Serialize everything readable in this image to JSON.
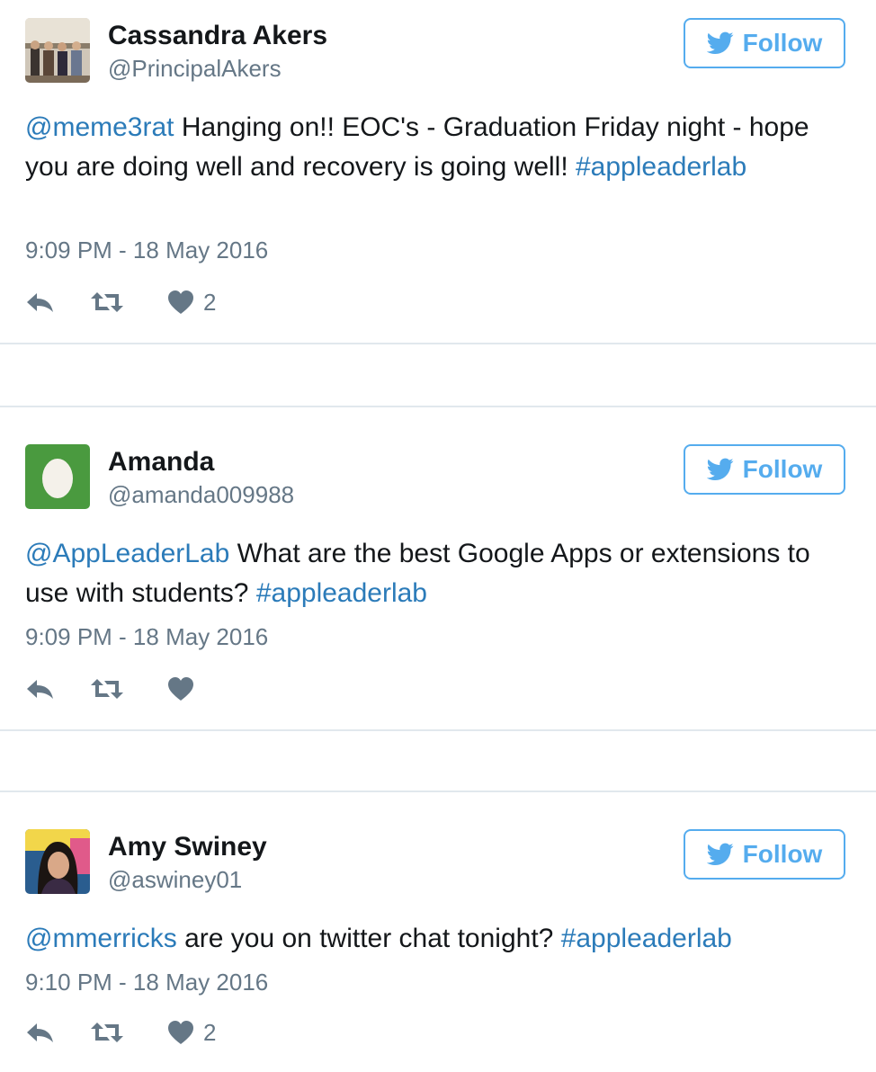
{
  "colors": {
    "link": "#2b7bb9",
    "follow_accent": "#55acee",
    "meta": "#657786",
    "egg_green": "#4a9a3f"
  },
  "tweets": [
    {
      "name": "Cassandra Akers",
      "handle": "@PrincipalAkers",
      "follow_label": "Follow",
      "text_parts": [
        "@meme3rat",
        " Hanging on!! EOC's - Graduation Friday night - hope you are doing well and recovery is going well! ",
        "#appleaderlab"
      ],
      "timestamp": "9:09 PM - 18 May 2016",
      "like_count": "2"
    },
    {
      "name": "Amanda",
      "handle": "@amanda009988",
      "follow_label": "Follow",
      "text_parts": [
        "@AppLeaderLab",
        " What are the best Google Apps or extensions to use with students? ",
        "#appleaderlab"
      ],
      "timestamp": "9:09 PM - 18 May 2016",
      "like_count": ""
    },
    {
      "name": "Amy Swiney",
      "handle": "@aswiney01",
      "follow_label": "Follow",
      "text_parts": [
        "@mmerricks",
        " are you on twitter chat tonight? ",
        "#appleaderlab"
      ],
      "timestamp": "9:10 PM - 18 May 2016",
      "like_count": "2"
    }
  ],
  "icons": {
    "reply": "reply-icon",
    "retweet": "retweet-icon",
    "like": "heart-icon",
    "bird": "twitter-bird-icon"
  }
}
